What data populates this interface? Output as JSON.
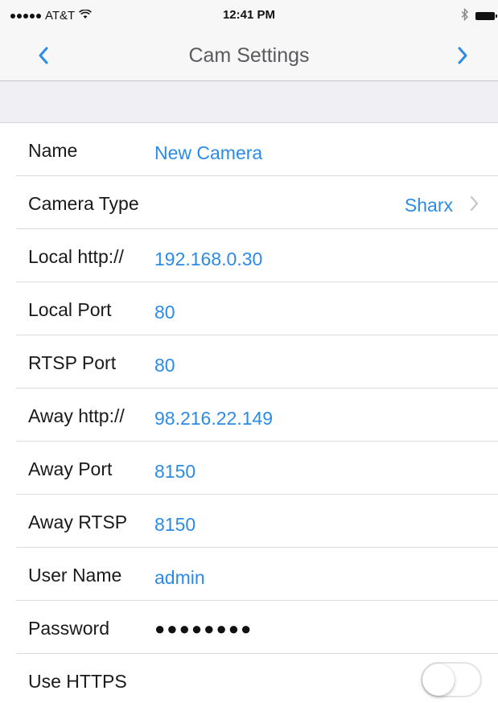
{
  "status_bar": {
    "carrier": "AT&T",
    "time": "12:41 PM",
    "icons": [
      "signal-dots-icon",
      "wifi-icon",
      "bluetooth-icon",
      "battery-icon"
    ]
  },
  "nav_bar": {
    "title": "Cam Settings",
    "back_icon": "chevron-left-icon",
    "forward_icon": "chevron-right-icon",
    "accent_color": "#2c8be6"
  },
  "settings": {
    "name": {
      "label": "Name",
      "value": "New Camera"
    },
    "camera_type": {
      "label": "Camera Type",
      "value": "Sharx"
    },
    "local_http": {
      "label": "Local http://",
      "value": "192.168.0.30"
    },
    "local_port": {
      "label": "Local Port",
      "value": "80"
    },
    "rtsp_port": {
      "label": "RTSP Port",
      "value": "80"
    },
    "away_http": {
      "label": "Away http://",
      "value": "98.216.22.149"
    },
    "away_port": {
      "label": "Away Port",
      "value": "8150"
    },
    "away_rtsp": {
      "label": "Away RTSP",
      "value": "8150"
    },
    "user_name": {
      "label": "User Name",
      "value": "admin"
    },
    "password": {
      "label": "Password",
      "value": "●●●●●●●●"
    },
    "use_https": {
      "label": "Use HTTPS",
      "on": false
    }
  }
}
